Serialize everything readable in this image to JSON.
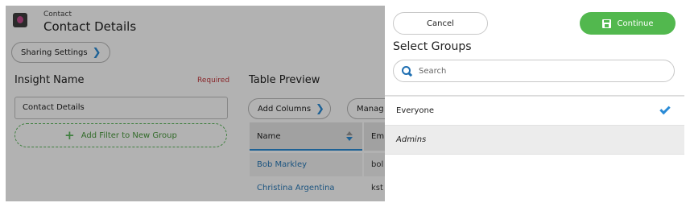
{
  "header": {
    "breadcrumb_small": "Contact",
    "title": "Contact Details"
  },
  "sharing": {
    "label": "Sharing Settings"
  },
  "insight": {
    "title": "Insight Name",
    "required": "Required",
    "value": "Contact Details"
  },
  "filter": {
    "label": "Add Filter to New Group"
  },
  "preview": {
    "title": "Table Preview",
    "add_columns": "Add Columns",
    "manage": "Manag",
    "columns": [
      "Name",
      "Em"
    ],
    "rows": [
      {
        "name": "Bob Markley",
        "email": "bol"
      },
      {
        "name": "Christina Argentina",
        "email": "kst"
      }
    ]
  },
  "panel": {
    "cancel": "Cancel",
    "continue": "Continue",
    "title": "Select Groups",
    "search_placeholder": "Search",
    "groups": [
      {
        "label": "Everyone",
        "selected": true
      },
      {
        "label": "Admins",
        "selected": false
      }
    ]
  },
  "colors": {
    "accent": "#2a8bd6",
    "continue": "#52b84e",
    "required": "#c4373c",
    "overlay": "rgba(0,0,0,0.30)"
  },
  "icons": [
    "contact-app-icon",
    "chevron-right-icon",
    "plus-icon",
    "sort-icon",
    "save-icon",
    "search-icon",
    "checkmark-icon"
  ]
}
